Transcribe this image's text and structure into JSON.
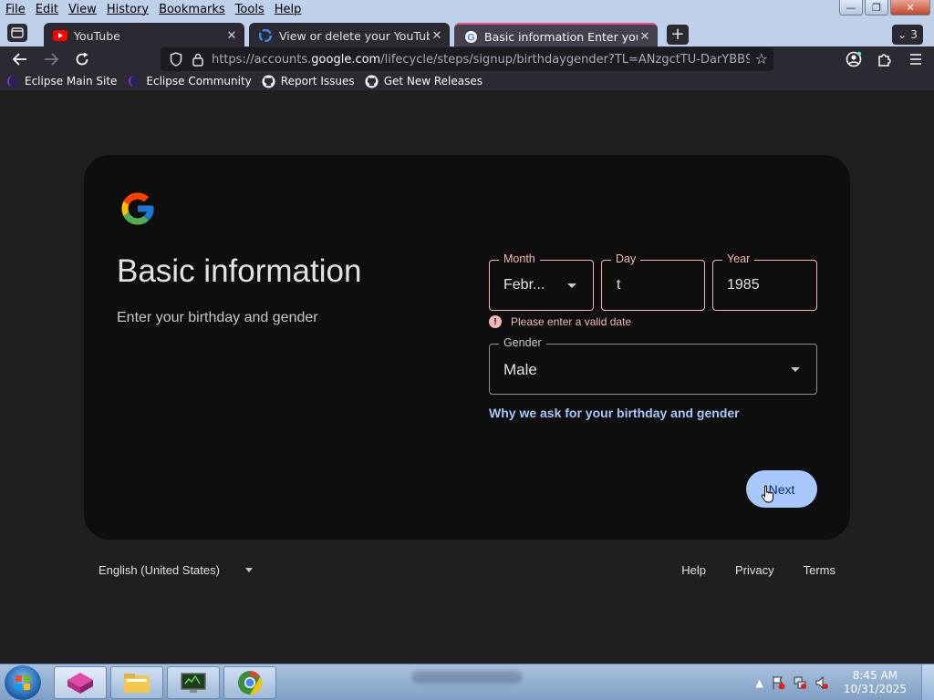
{
  "menu": [
    "File",
    "Edit",
    "View",
    "History",
    "Bookmarks",
    "Tools",
    "Help"
  ],
  "window": {
    "minimize": "—",
    "restore": "❐",
    "close": "✕"
  },
  "tabs": [
    {
      "title": "YouTube",
      "icon": "youtube-icon"
    },
    {
      "title": "View or delete your YouTube sea",
      "icon": "google-icon"
    },
    {
      "title": "Basic information Enter your bir",
      "icon": "google-icon",
      "active": true
    }
  ],
  "tab_count": "3",
  "url": {
    "prefix": "https://accounts.",
    "domain": "google.com",
    "path": "/lifecycle/steps/signup/birthdaygender?TL=ANzgctTU-DarYBB9ZFRS..."
  },
  "bookmarks": [
    {
      "label": "Eclipse Main Site",
      "icon": "eclipse-icon"
    },
    {
      "label": "Eclipse Community",
      "icon": "eclipse-icon"
    },
    {
      "label": "Report Issues",
      "icon": "github-icon"
    },
    {
      "label": "Get New Releases",
      "icon": "github-icon"
    }
  ],
  "page": {
    "heading": "Basic information",
    "subheading": "Enter your birthday and gender",
    "month": {
      "label": "Month",
      "value": "Febr..."
    },
    "day": {
      "label": "Day",
      "value": "t"
    },
    "year": {
      "label": "Year",
      "value": "1985"
    },
    "error": "Please enter a valid date",
    "gender": {
      "label": "Gender",
      "value": "Male"
    },
    "why_link": "Why we ask for your birthday and gender",
    "next": "Next"
  },
  "footer": {
    "language": "English (United States)",
    "links": [
      "Help",
      "Privacy",
      "Terms"
    ]
  },
  "taskbar": {
    "time": "8:45 AM",
    "date": "10/31/2025"
  },
  "colors": {
    "accent": "#a8c7fa",
    "error": "#f2b8b5",
    "active_tab": "#e64f7f"
  }
}
